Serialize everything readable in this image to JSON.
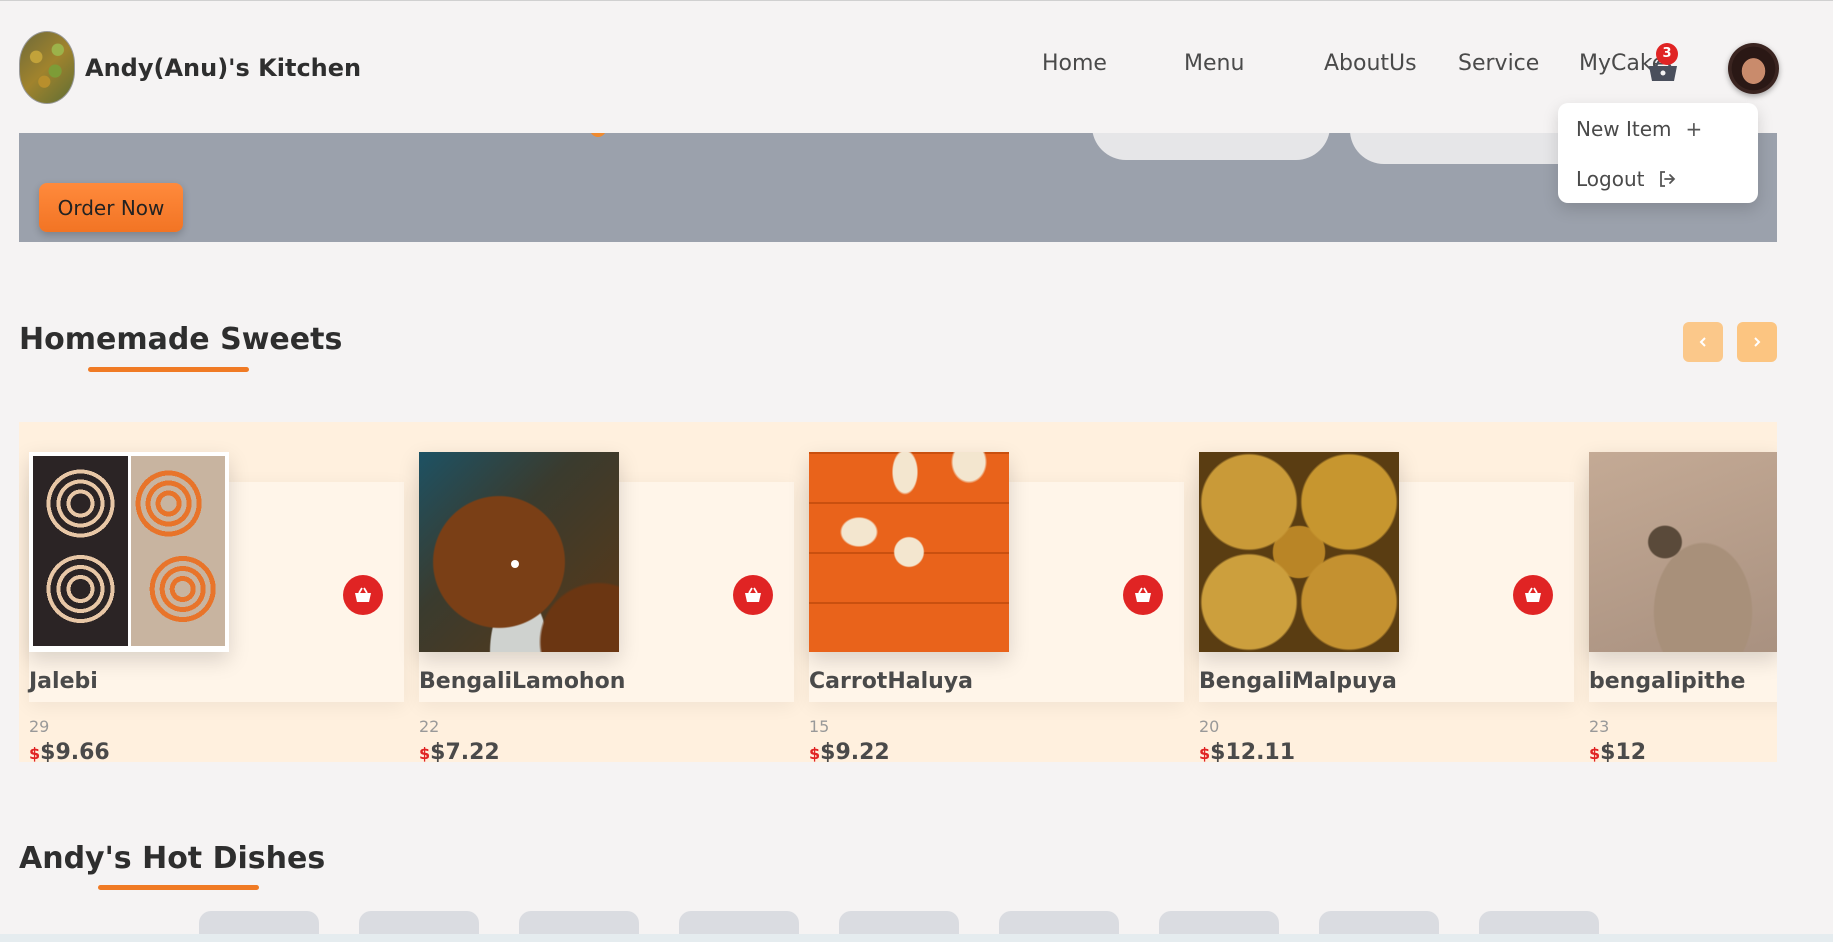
{
  "header": {
    "brand": "Andy(Anu)'s Kitchen",
    "nav": [
      "Home",
      "Menu",
      "AboutUs",
      "Service",
      "MyCake"
    ],
    "cart_count": "3"
  },
  "dropdown": {
    "new_item": "New Item",
    "logout": "Logout"
  },
  "hero": {
    "order_button": "Order Now"
  },
  "sweets": {
    "title": "Homemade Sweets",
    "items": [
      {
        "name": "Jalebi",
        "qty": "29",
        "currency": "$",
        "price": "$9.66"
      },
      {
        "name": "BengaliLamohon",
        "qty": "22",
        "currency": "$",
        "price": "$7.22"
      },
      {
        "name": "CarrotHaluya",
        "qty": "15",
        "currency": "$",
        "price": "$9.22"
      },
      {
        "name": "BengaliMalpuya",
        "qty": "20",
        "currency": "$",
        "price": "$12.11"
      },
      {
        "name": "bengalipithe",
        "qty": "23",
        "currency": "$",
        "price": "$12"
      }
    ]
  },
  "hot_dishes": {
    "title": "Andy's Hot Dishes"
  },
  "icons": {
    "cart": "shopping-basket-icon",
    "add_to_cart": "basket-icon",
    "new_item": "plus-icon",
    "logout": "logout-icon",
    "prev": "chevron-left-icon",
    "next": "chevron-right-icon"
  },
  "colors": {
    "accent": "#f07a24",
    "danger": "#e02424",
    "carousel_bg": "#fff0de"
  }
}
